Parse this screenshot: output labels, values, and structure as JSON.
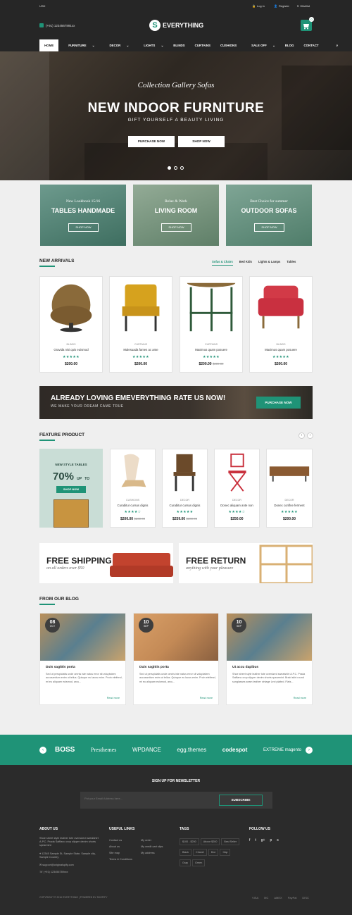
{
  "topbar": {
    "currency": "USD",
    "login": "Log in",
    "register": "Register",
    "wishlist": "Wishlist"
  },
  "header": {
    "phone": "(+91) 1234567891xx",
    "logo_text": "EVERYTHING",
    "logo_mark": "S",
    "cart_count": "0"
  },
  "nav": {
    "items": [
      "HOME",
      "FURNITURE",
      "DECOR",
      "LIGHTS",
      "BLINDS",
      "CURTAINS",
      "CUSHIONS",
      "SALE OFF",
      "BLOG",
      "CONTACT"
    ]
  },
  "hero": {
    "script": "Collection Gallery Sofas",
    "title": "NEW INDOOR FURNITURE",
    "subtitle": "GIFT YOURSELF A BEAUTY LIVING",
    "btn1": "PURCHASE NOW",
    "btn2": "SHOP NOW"
  },
  "banners": [
    {
      "small": "New Lookbook 15/16",
      "big": "TABLES HANDMADE",
      "btn": "SHOP NOW",
      "color": "#5d8c7e"
    },
    {
      "small": "Relax & Work",
      "big": "LIVING ROOM",
      "btn": "SHOP NOW",
      "color": "#7f9b85"
    },
    {
      "small": "Best Choice for summer",
      "big": "OUTDOOR SOFAS",
      "btn": "SHOP NOW",
      "color": "#6b9886"
    }
  ],
  "new_arrivals": {
    "title": "NEW ARRIVALS",
    "tabs": [
      "Sofas & Chairs",
      "Bed Kids",
      "Lights & Lamps",
      "Tables"
    ],
    "products": [
      {
        "cat": "BLINDS",
        "name": "Gravida nisi quis euismod",
        "stars": "★★★★★",
        "price": "$200.00",
        "old": ""
      },
      {
        "cat": "CURTAINS",
        "name": "Malesuada fames ac ante",
        "stars": "★★★★★",
        "price": "$200.00",
        "old": ""
      },
      {
        "cat": "CURTAINS",
        "name": "Maximus quam posuere",
        "stars": "★★★★★",
        "price": "$200.00",
        "old": "$300.00"
      },
      {
        "cat": "BLINDS",
        "name": "Maximus quam posuere",
        "stars": "★★★★★",
        "price": "$200.00",
        "old": ""
      }
    ]
  },
  "rate": {
    "title": "ALREADY LOVING EMEVERYTHING RATE US NOW!",
    "sub": "WE MAKE YOUR DREAM CAME TRUE",
    "btn": "PURCHASE NOW"
  },
  "feature": {
    "title": "FEATURE PRODUCT",
    "promo_small": "NEW STYLE TABLES",
    "promo_pct": "70%",
    "promo_up": "UP",
    "promo_to": "TO",
    "promo_btn": "SHOP NOW",
    "products": [
      {
        "cat": "CUSHIONS",
        "name": "Curabitur cursus dignis",
        "stars": "★★★★☆",
        "price": "$200.00",
        "old": "$230.00"
      },
      {
        "cat": "DECOR",
        "name": "Curabitur cursus dignis",
        "stars": "★★★★★",
        "price": "$259.00",
        "old": "$300.00"
      },
      {
        "cat": "DECOR",
        "name": "Donec aliquam ante non",
        "stars": "★★★★☆",
        "price": "$250.00",
        "old": ""
      },
      {
        "cat": "DECOR",
        "name": "Donec conflne ferment",
        "stars": "★★★★★",
        "price": "$200.00",
        "old": ""
      }
    ]
  },
  "shipping": {
    "a_title": "FREE SHIPPING",
    "a_sub": "on all orders over $50",
    "b_title": "FREE RETURN",
    "b_sub": "anything with your pleasure"
  },
  "blog": {
    "title": "FROM OUR BLOG",
    "posts": [
      {
        "day": "08",
        "mon": "OCT",
        "title": "Duis sagittis porta",
        "text": "Sed ut perspiciatis unde omnis iste natus error sit voluptatem accusantium enim ut tellus. Quisque eu lacus enim. Proin eleifend, mi eu aliquam euismod, arcu...",
        "more": "Read more"
      },
      {
        "day": "10",
        "mon": "SEP",
        "title": "Duis sagittis porta",
        "text": "Sed ut perspiciatis unde omnis iste natus error sit voluptatem accusantium enim ut tellus. Quisque eu lacus enim. Proin eleifend, mi eu aliquam euismod, arcu...",
        "more": "Read more"
      },
      {
        "day": "10",
        "mon": "SEP",
        "title": "Ut accu dapibus",
        "text": "Shoe street style leather tote oversized sweatshirt A.P.C. Prada Saffiano crop slipper denim shorts spearmint. Braid skirt round sunglasses seam leather vintage Levi plaited. Flats...",
        "more": "Read more"
      }
    ]
  },
  "brands": [
    "BOSS",
    "Presthemes",
    "WPDANCE",
    "egg.themes",
    "codespot",
    "EXTREME magento"
  ],
  "footer": {
    "newsletter_title": "SIGN UP FOR NEWSLETTER",
    "newsletter_placeholder": "Put your Email Address here...",
    "subscribe": "SUBSCRIBE",
    "about_title": "ABOUT US",
    "about_text": "Shoe street style leather tote oversized sweatshirt A.P.C. Prada Saffiano crop slipper denim shorts spearmint",
    "address": "12345 Sample St, Sample State, Sample city, Sample Country",
    "email": "support@originalspify.com",
    "phone": "(+91) 123456789xxx",
    "links_title": "USEFUL LINKS",
    "links_a": [
      "Contact us",
      "About us",
      "Site map",
      "Terms & Conditions"
    ],
    "links_b": [
      "My order",
      "My credit cart slips",
      "My address"
    ],
    "tags_title": "TAGS",
    "tags": [
      "$100 - $200",
      "Above $200",
      "Best Seller",
      "Black",
      "Chanel",
      "Dior",
      "Gap",
      "Gray",
      "Green"
    ],
    "follow_title": "FOLLOW US",
    "social": [
      "f",
      "t",
      "g+",
      "p",
      "s"
    ],
    "copyright": "COPYRIGHT © 2016 EVERYTHING | POWERED BY SHOPIFY",
    "payments": [
      "VISA",
      "MC",
      "AMEX",
      "PayPal",
      "DISC"
    ]
  },
  "colors": {
    "accent": "#1f9377",
    "dark": "#262626"
  }
}
